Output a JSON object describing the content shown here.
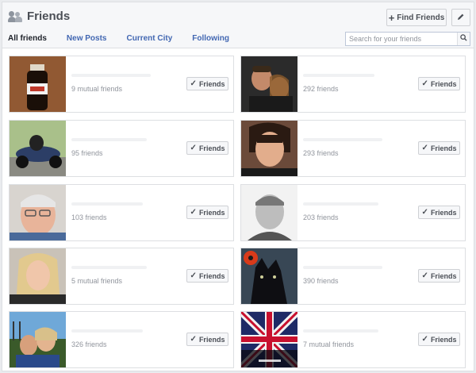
{
  "header": {
    "title": "Friends",
    "find_friends_label": "Find Friends",
    "find_friends_icon": "plus-icon",
    "edit_icon": "pencil-icon"
  },
  "tabs": [
    {
      "label": "All friends",
      "active": true
    },
    {
      "label": "New Posts",
      "active": false
    },
    {
      "label": "Current City",
      "active": false
    },
    {
      "label": "Following",
      "active": false
    }
  ],
  "search": {
    "placeholder": "Search for your friends",
    "value": ""
  },
  "friends": [
    {
      "subtext": "9 mutual friends",
      "button_label": "Friends",
      "photo": "bottle"
    },
    {
      "subtext": "292 friends",
      "button_label": "Friends",
      "photo": "couple-selfie"
    },
    {
      "subtext": "95 friends",
      "button_label": "Friends",
      "photo": "motorbike"
    },
    {
      "subtext": "293 friends",
      "button_label": "Friends",
      "photo": "woman-dark-hair"
    },
    {
      "subtext": "103 friends",
      "button_label": "Friends",
      "photo": "older-man-glasses"
    },
    {
      "subtext": "203 friends",
      "button_label": "Friends",
      "photo": "man-bw"
    },
    {
      "subtext": "5 mutual friends",
      "button_label": "Friends",
      "photo": "woman-blonde"
    },
    {
      "subtext": "390 friends",
      "button_label": "Friends",
      "photo": "wolf-poppy"
    },
    {
      "subtext": "326 friends",
      "button_label": "Friends",
      "photo": "couple-outdoors"
    },
    {
      "subtext": "7 mutual friends",
      "button_label": "Friends",
      "photo": "union-flag"
    }
  ],
  "colors": {
    "link": "#4267b2",
    "header_bg": "#f6f7f9",
    "border": "#dddfe2",
    "muted_text": "#90949c"
  }
}
